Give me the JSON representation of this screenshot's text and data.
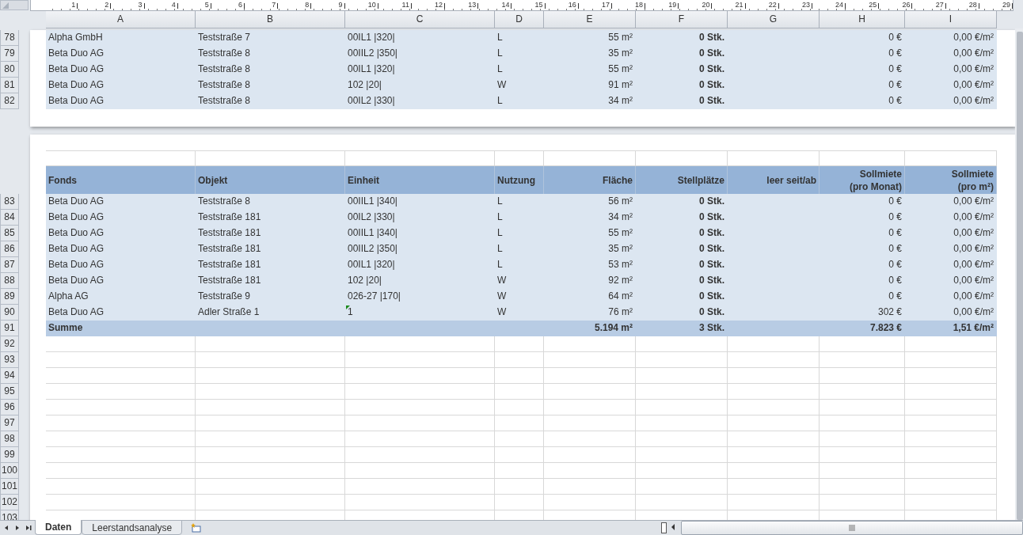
{
  "ruler": [
    "1",
    "2",
    "3",
    "4",
    "5",
    "6",
    "7",
    "8",
    "9",
    "10",
    "11",
    "12",
    "13",
    "14",
    "15",
    "16",
    "17",
    "18",
    "19",
    "20",
    "21",
    "22",
    "23",
    "24",
    "25",
    "26",
    "27",
    "28",
    "29"
  ],
  "columns": [
    "A",
    "B",
    "C",
    "D",
    "E",
    "F",
    "G",
    "H",
    "I"
  ],
  "page_1": {
    "rows": [
      {
        "number": "78",
        "fonds": "Alpha GmbH",
        "objekt": "Teststraße 7",
        "einheit": "00IL1 |320|",
        "nutzung": "L",
        "flaeche": "55 m²",
        "stellplaetze": "0 Stk.",
        "sollmiete_monat": "0 €",
        "sollmiete_m2": "0,00 €/m²"
      },
      {
        "number": "79",
        "fonds": "Beta Duo AG",
        "objekt": "Teststraße 8",
        "einheit": "00IIL2 |350|",
        "nutzung": "L",
        "flaeche": "35 m²",
        "stellplaetze": "0 Stk.",
        "sollmiete_monat": "0 €",
        "sollmiete_m2": "0,00 €/m²"
      },
      {
        "number": "80",
        "fonds": "Beta Duo AG",
        "objekt": "Teststraße 8",
        "einheit": "00IL1 |320|",
        "nutzung": "L",
        "flaeche": "55 m²",
        "stellplaetze": "0 Stk.",
        "sollmiete_monat": "0 €",
        "sollmiete_m2": "0,00 €/m²"
      },
      {
        "number": "81",
        "fonds": "Beta Duo AG",
        "objekt": "Teststraße 8",
        "einheit": "102 |20|",
        "nutzung": "W",
        "flaeche": "91 m²",
        "stellplaetze": "0 Stk.",
        "sollmiete_monat": "0 €",
        "sollmiete_m2": "0,00 €/m²"
      },
      {
        "number": "82",
        "fonds": "Beta Duo AG",
        "objekt": "Teststraße 8",
        "einheit": "00IL2 |330|",
        "nutzung": "L",
        "flaeche": "34 m²",
        "stellplaetze": "0 Stk.",
        "sollmiete_monat": "0 €",
        "sollmiete_m2": "0,00 €/m²"
      }
    ]
  },
  "page_2": {
    "header": [
      "Fonds",
      "Objekt",
      "Einheit",
      "Nutzung",
      "Fläche",
      "Stellplätze",
      "leer seit/ab",
      "Sollmiete\n(pro Monat)",
      "Sollmiete\n(pro m²)"
    ],
    "rows": [
      {
        "number": "83",
        "fonds": "Beta Duo AG",
        "objekt": "Teststraße 8",
        "einheit": "00IIL1 |340|",
        "nutzung": "L",
        "flaeche": "56 m²",
        "stellplaetze": "0 Stk.",
        "sollmiete_monat": "0 €",
        "sollmiete_m2": "0,00 €/m²",
        "warning": false
      },
      {
        "number": "84",
        "fonds": "Beta Duo AG",
        "objekt": "Teststraße 181",
        "einheit": "00IL2 |330|",
        "nutzung": "L",
        "flaeche": "34 m²",
        "stellplaetze": "0 Stk.",
        "sollmiete_monat": "0 €",
        "sollmiete_m2": "0,00 €/m²",
        "warning": false
      },
      {
        "number": "85",
        "fonds": "Beta Duo AG",
        "objekt": "Teststraße 181",
        "einheit": "00IIL1 |340|",
        "nutzung": "L",
        "flaeche": "55 m²",
        "stellplaetze": "0 Stk.",
        "sollmiete_monat": "0 €",
        "sollmiete_m2": "0,00 €/m²",
        "warning": false
      },
      {
        "number": "86",
        "fonds": "Beta Duo AG",
        "objekt": "Teststraße 181",
        "einheit": "00IIL2 |350|",
        "nutzung": "L",
        "flaeche": "35 m²",
        "stellplaetze": "0 Stk.",
        "sollmiete_monat": "0 €",
        "sollmiete_m2": "0,00 €/m²",
        "warning": false
      },
      {
        "number": "87",
        "fonds": "Beta Duo AG",
        "objekt": "Teststraße 181",
        "einheit": "00IL1 |320|",
        "nutzung": "L",
        "flaeche": "53 m²",
        "stellplaetze": "0 Stk.",
        "sollmiete_monat": "0 €",
        "sollmiete_m2": "0,00 €/m²",
        "warning": false
      },
      {
        "number": "88",
        "fonds": "Beta Duo AG",
        "objekt": "Teststraße 181",
        "einheit": "102 |20|",
        "nutzung": "W",
        "flaeche": "92 m²",
        "stellplaetze": "0 Stk.",
        "sollmiete_monat": "0 €",
        "sollmiete_m2": "0,00 €/m²",
        "warning": false
      },
      {
        "number": "89",
        "fonds": "Alpha AG",
        "objekt": "Teststraße 9",
        "einheit": "026-27 |170|",
        "nutzung": "W",
        "flaeche": "64 m²",
        "stellplaetze": "0 Stk.",
        "sollmiete_monat": "0 €",
        "sollmiete_m2": "0,00 €/m²",
        "warning": false
      },
      {
        "number": "90",
        "fonds": "Beta Duo AG",
        "objekt": "Adler Straße 1",
        "einheit": "1",
        "nutzung": "W",
        "flaeche": "76 m²",
        "stellplaetze": "0 Stk.",
        "sollmiete_monat": "302 €",
        "sollmiete_m2": "0,00 €/m²",
        "warning": true
      }
    ],
    "summary": {
      "number": "91",
      "label": "Summe",
      "flaeche": "5.194 m²",
      "stellplaetze": "3 Stk.",
      "sollmiete_monat": "7.823 €",
      "sollmiete_m2": "1,51 €/m²"
    },
    "empty_rows": [
      "92",
      "93",
      "94",
      "95",
      "96",
      "97",
      "98",
      "99",
      "100",
      "101",
      "102",
      "103"
    ]
  },
  "sheet_tabs": [
    {
      "label": "Daten",
      "selected": true
    },
    {
      "label": "Leerstandsanalyse",
      "selected": false
    }
  ]
}
